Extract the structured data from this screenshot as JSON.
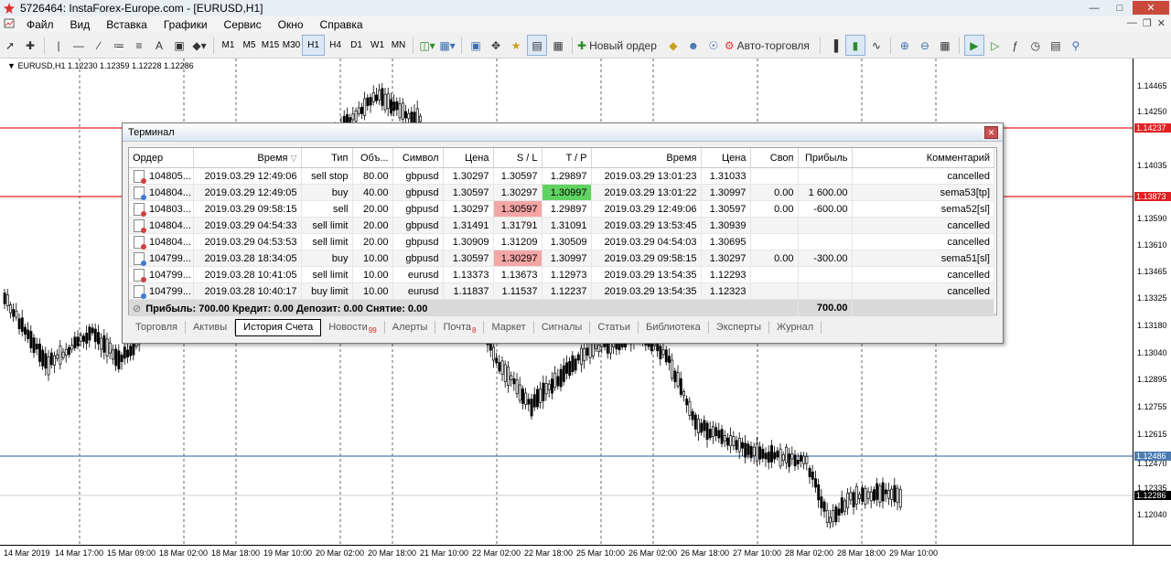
{
  "window": {
    "title": "5726464: InstaForex-Europe.com - [EURUSD,H1]"
  },
  "menu": [
    "Файл",
    "Вид",
    "Вставка",
    "Графики",
    "Сервис",
    "Окно",
    "Справка"
  ],
  "toolbar": {
    "timeframes": [
      "M1",
      "M5",
      "M15",
      "M30",
      "H1",
      "H4",
      "D1",
      "W1",
      "MN"
    ],
    "active_timeframe": "H1",
    "new_order_label": "Новый ордер",
    "autotrading_label": "Авто-торговля"
  },
  "chart": {
    "symbol_info": "EURUSD,H1  1.12230 1.12359 1.12228 1.12286",
    "price_labels": [
      "1.14465",
      "1.14250",
      "1.14035",
      "1.13800",
      "1.13590",
      "1.13610",
      "1.13465",
      "1.13325",
      "1.13180",
      "1.13040",
      "1.12895",
      "1.12755",
      "1.12615",
      "1.12470",
      "1.12335",
      "1.12190",
      "1.12040"
    ],
    "price_tags": [
      {
        "text": "1.14237",
        "color": "#e02020"
      },
      {
        "text": "1.13873",
        "color": "#e02020"
      },
      {
        "text": "1.12486",
        "color": "#4a7ab0"
      },
      {
        "text": "1.12286",
        "color": "#000000"
      }
    ],
    "time_labels": [
      "14 Mar 2019",
      "14 Mar 17:00",
      "15 Mar 09:00",
      "18 Mar 02:00",
      "18 Mar 18:00",
      "19 Mar 10:00",
      "20 Mar 02:00",
      "20 Mar 18:00",
      "21 Mar 10:00",
      "22 Mar 02:00",
      "22 Mar 18:00",
      "25 Mar 10:00",
      "26 Mar 02:00",
      "26 Mar 18:00",
      "27 Mar 10:00",
      "28 Mar 02:00",
      "28 Mar 18:00",
      "29 Mar 10:00"
    ],
    "colors": {
      "level_red": "#e02020",
      "level_blue": "#4a7ab0",
      "candles": "#000000"
    }
  },
  "terminal": {
    "title": "Терминал",
    "columns": [
      "Ордер",
      "Время",
      "Тип",
      "Объ...",
      "Символ",
      "Цена",
      "S / L",
      "T / P",
      "Время",
      "Цена",
      "Своп",
      "Прибыль",
      "Комментарий"
    ],
    "rows": [
      [
        "104805...",
        "2019.03.29 12:49:06",
        "sell stop",
        "80.00",
        "gbpusd",
        "1.30297",
        "1.30597",
        "1.29897",
        "2019.03.29 13:01:23",
        "1.31033",
        "",
        "",
        "cancelled"
      ],
      [
        "104804...",
        "2019.03.29 12:49:05",
        "buy",
        "40.00",
        "gbpusd",
        "1.30597",
        "1.30297",
        "1.30997",
        "2019.03.29 13:01:22",
        "1.30997",
        "0.00",
        "1 600.00",
        "sema53[tp]"
      ],
      [
        "104803...",
        "2019.03.29 09:58:15",
        "sell",
        "20.00",
        "gbpusd",
        "1.30297",
        "1.30597",
        "1.29897",
        "2019.03.29 12:49:06",
        "1.30597",
        "0.00",
        "-600.00",
        "sema52[sl]"
      ],
      [
        "104804...",
        "2019.03.29 04:54:33",
        "sell limit",
        "20.00",
        "gbpusd",
        "1.31491",
        "1.31791",
        "1.31091",
        "2019.03.29 13:53:45",
        "1.30939",
        "",
        "",
        "cancelled"
      ],
      [
        "104804...",
        "2019.03.29 04:53:53",
        "sell limit",
        "20.00",
        "gbpusd",
        "1.30909",
        "1.31209",
        "1.30509",
        "2019.03.29 04:54:03",
        "1.30695",
        "",
        "",
        "cancelled"
      ],
      [
        "104799...",
        "2019.03.28 18:34:05",
        "buy",
        "10.00",
        "gbpusd",
        "1.30597",
        "1.30297",
        "1.30997",
        "2019.03.29 09:58:15",
        "1.30297",
        "0.00",
        "-300.00",
        "sema51[sl]"
      ],
      [
        "104799...",
        "2019.03.28 10:41:05",
        "sell limit",
        "10.00",
        "eurusd",
        "1.13373",
        "1.13673",
        "1.12973",
        "2019.03.29 13:54:35",
        "1.12293",
        "",
        "",
        "cancelled"
      ],
      [
        "104799...",
        "2019.03.28 10:40:17",
        "buy limit",
        "10.00",
        "eurusd",
        "1.11837",
        "1.11537",
        "1.12237",
        "2019.03.29 13:54:35",
        "1.12323",
        "",
        "",
        "cancelled"
      ]
    ],
    "summary": "Прибыль: 700.00  Кредит: 0.00  Депозит: 0.00  Снятие: 0.00",
    "summary_total": "700.00",
    "tabs": [
      {
        "label": "Торговля",
        "badge": ""
      },
      {
        "label": "Активы",
        "badge": ""
      },
      {
        "label": "История Счета",
        "badge": ""
      },
      {
        "label": "Новости",
        "badge": "99"
      },
      {
        "label": "Алерты",
        "badge": ""
      },
      {
        "label": "Почта",
        "badge": "8"
      },
      {
        "label": "Маркет",
        "badge": ""
      },
      {
        "label": "Сигналы",
        "badge": ""
      },
      {
        "label": "Статьи",
        "badge": ""
      },
      {
        "label": "Библиотека",
        "badge": ""
      },
      {
        "label": "Эксперты",
        "badge": ""
      },
      {
        "label": "Журнал",
        "badge": ""
      }
    ],
    "active_tab": "История Счета"
  }
}
